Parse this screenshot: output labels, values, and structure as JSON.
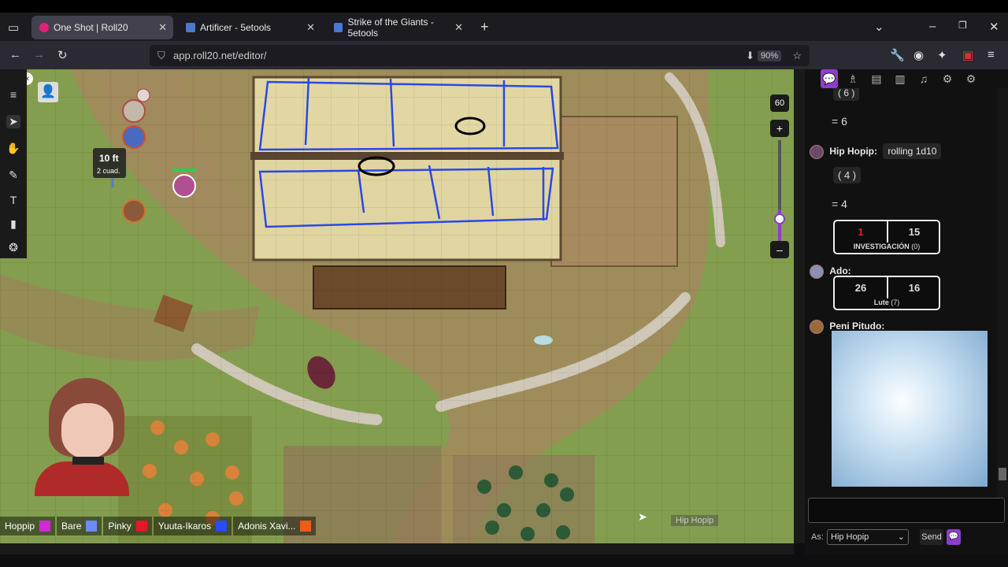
{
  "browser": {
    "tabs": [
      {
        "title": "One Shot | Roll20",
        "active": true
      },
      {
        "title": "Artificer - 5etools",
        "active": false
      },
      {
        "title": "Strike of the Giants - 5etools",
        "active": false
      }
    ],
    "url": "app.roll20.net/editor/",
    "zoom": "90%"
  },
  "map": {
    "ruler_distance": "10 ft",
    "ruler_squares": "2 cuad.",
    "zoom_value": "60",
    "cursor_label": "Hip Hopip"
  },
  "players": [
    {
      "name": "Hoppip",
      "color": "#d02ad8"
    },
    {
      "name": "Bare",
      "color": "#6b8cff"
    },
    {
      "name": "Pinky",
      "color": "#e0182b"
    },
    {
      "name": "Yuuta-Ikaros",
      "color": "#2a4cf0"
    },
    {
      "name": "Adonis Xavi...",
      "color": "#f05a1a"
    }
  ],
  "chat": {
    "top_result": "( 6 )",
    "top_total": "= 6",
    "msg1": {
      "sender": "Hip Hopip:",
      "text": "rolling 1d10",
      "dice": "( 4 )",
      "total": "= 4",
      "roll": {
        "left": "1",
        "right": "15",
        "label": "INVESTIGACIÓN",
        "sub": "(0)"
      }
    },
    "msg2": {
      "sender": "Ado:",
      "roll": {
        "left": "26",
        "right": "16",
        "label": "Lute",
        "sub": "(7)"
      }
    },
    "msg3": {
      "sender": "Peni Pitudo:"
    },
    "as_label": "As:",
    "as_value": "Hip Hopip",
    "send_label": "Send"
  }
}
